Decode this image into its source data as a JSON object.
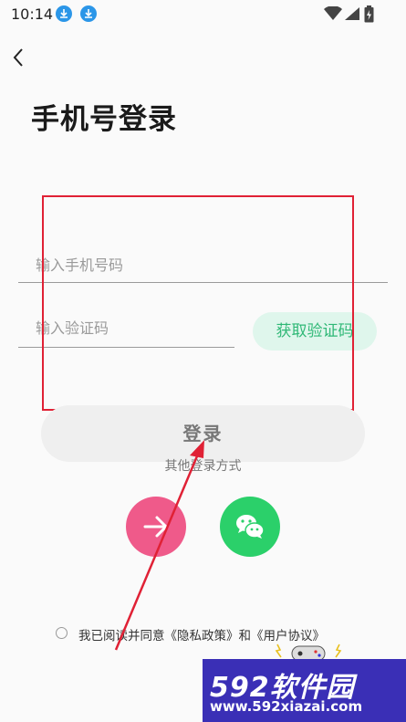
{
  "status_bar": {
    "time": "10:14"
  },
  "header": {
    "title": "手机号登录"
  },
  "form": {
    "phone_placeholder": "输入手机号码",
    "code_placeholder": "输入验证码",
    "get_code_label": "获取验证码",
    "login_label": "登录"
  },
  "other_login": {
    "label": "其他登录方式"
  },
  "agreement": {
    "text": "我已阅读并同意《隐私政策》和《用户协议》"
  },
  "watermark": {
    "brand": "592软件园",
    "url": "www.592xiazai.com"
  },
  "colors": {
    "accent_green": "#2fb876",
    "quick_login_pink": "#ef5a8a",
    "wechat_green": "#2bd06a",
    "annotation_red": "#e02135",
    "watermark_blue": "#3a2fb6"
  },
  "icons": [
    "download-icon",
    "wifi-icon",
    "signal-icon",
    "battery-icon",
    "back-icon",
    "arrow-right-icon",
    "wechat-icon"
  ]
}
